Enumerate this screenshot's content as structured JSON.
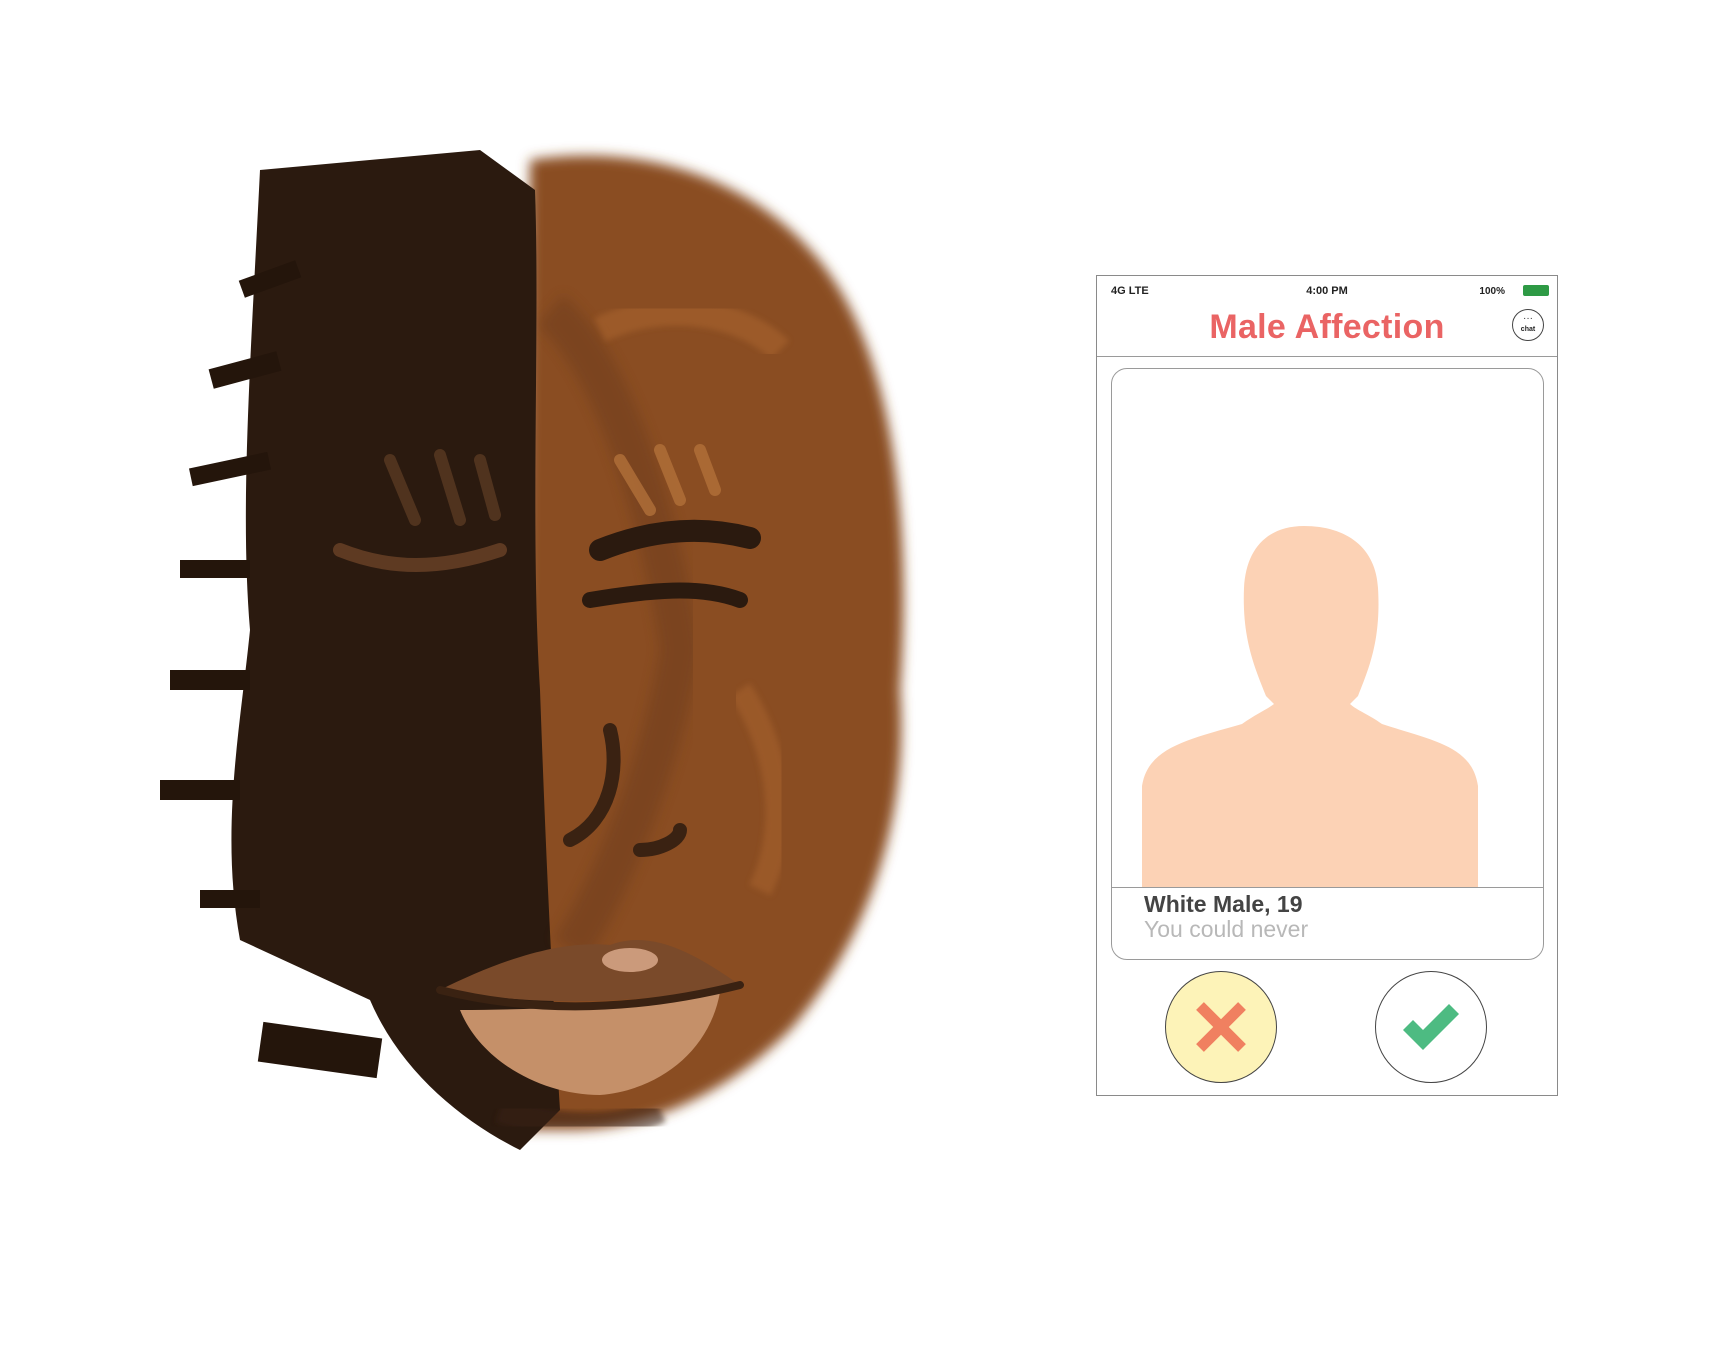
{
  "status_bar": {
    "carrier": "4G LTE",
    "time": "4:00 PM",
    "battery": "100%",
    "battery_level": 1.0,
    "battery_color": "#2e9a45"
  },
  "app": {
    "title": "Male Affection",
    "title_color": "#ea6464",
    "chat_label": "chat",
    "chat_icon": "chat-bubble-icon"
  },
  "profile": {
    "name": "White Male, 19",
    "tagline": "You could never",
    "silhouette_color": "#fcd2b5",
    "photo_icon": "person-silhouette-icon"
  },
  "actions": {
    "reject_icon": "x-icon",
    "reject_color": "#f08060",
    "reject_bg": "#fdf3b8",
    "accept_icon": "checkmark-icon",
    "accept_color": "#4dbb82"
  },
  "artwork": {
    "subject": "painted-face-icon",
    "colors": [
      "#2b1a0f",
      "#8a4d22",
      "#5e3418",
      "#c59069"
    ]
  }
}
